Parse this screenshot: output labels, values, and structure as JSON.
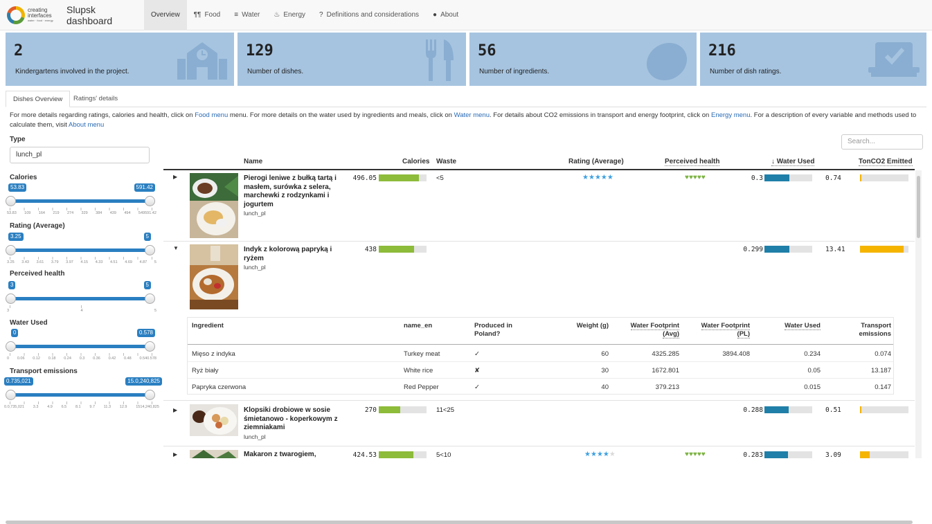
{
  "app": {
    "title": "Slupsk dashboard",
    "logo_line1": "creating",
    "logo_line2": "interfaces",
    "logo_line3": "water · food · energy"
  },
  "nav": [
    {
      "label": "Overview",
      "icon": "none",
      "active": true
    },
    {
      "label": "Food",
      "icon": "utensils-icon"
    },
    {
      "label": "Water",
      "icon": "bars-icon"
    },
    {
      "label": "Energy",
      "icon": "flame-icon"
    },
    {
      "label": "Definitions and considerations",
      "icon": "question-icon"
    },
    {
      "label": "About",
      "icon": "info-icon"
    }
  ],
  "value_boxes": [
    {
      "value": "2",
      "label": "Kindergartens involved in the project.",
      "icon": "school-icon"
    },
    {
      "value": "129",
      "label": "Number of dishes.",
      "icon": "utensils-icon"
    },
    {
      "value": "56",
      "label": "Number of ingredients.",
      "icon": "lemon-icon"
    },
    {
      "value": "216",
      "label": "Number of dish ratings.",
      "icon": "check-box-icon"
    }
  ],
  "value_box_color": "#a6c4e0",
  "tabs": [
    "Dishes Overview",
    "Ratings' details"
  ],
  "info": {
    "p1": "For more details regarding ratings, calories and health, click on ",
    "l1": "Food menu",
    "p2": " menu. For more details on the water used by ingredients and meals, click on ",
    "l2": "Water menu",
    "p3": ". For details about CO2 emissions in transport and energy footprint, click on ",
    "l3": "Energy menu",
    "p4": ". For a description of every variable and methods used to calculate them, visit ",
    "l4": "About menu"
  },
  "filters": {
    "type_label": "Type",
    "type_value": "lunch_pl",
    "calories": {
      "label": "Calories",
      "min": "53.83",
      "max": "591.42",
      "grid": [
        "53.83",
        "109",
        "164",
        "219",
        "274",
        "329",
        "384",
        "439",
        "494",
        "549591.42"
      ]
    },
    "rating": {
      "label": "Rating (Average)",
      "min": "3.25",
      "max": "5",
      "grid": [
        "3.25",
        "3.43",
        "3.61",
        "3.79",
        "3.97",
        "4.15",
        "4.33",
        "4.51",
        "4.69",
        "4.87",
        "5"
      ]
    },
    "health": {
      "label": "Perceived health",
      "min": "3",
      "max": "5",
      "grid": [
        "3",
        "4",
        "5"
      ]
    },
    "water": {
      "label": "Water Used",
      "min": "0",
      "max": "0.578",
      "grid": [
        "0",
        "0.06",
        "0.12",
        "0.18",
        "0.24",
        "0.3",
        "0.36",
        "0.42",
        "0.48",
        "0.540.578"
      ]
    },
    "transport": {
      "label": "Transport emissions",
      "min": "0.735,021",
      "max": "15.0,240,825",
      "grid": [
        "0.0,735,021",
        "3.3",
        "4.9",
        "6.5",
        "8.1",
        "9.7",
        "11.3",
        "12.9",
        "1514,240,825"
      ]
    }
  },
  "search_placeholder": "Search...",
  "table": {
    "headers": {
      "name": "Name",
      "calories": "Calories",
      "waste": "Waste",
      "rating": "Rating (Average)",
      "health": "Perceived health",
      "water": "↓ Water Used",
      "co2": "TonCO2 Emitted"
    },
    "rows": [
      {
        "expanded": false,
        "name": "Pierogi leniwe z bułką tartą i masłem, surówka z selera, marchewki z rodzynkami i jogurtem",
        "type": "lunch_pl",
        "calories": "496.05",
        "calories_frac": 0.84,
        "waste": "<5",
        "rating_stars": 5,
        "health_hearts": 5,
        "water": "0.3",
        "water_frac": 0.52,
        "co2": "0.74",
        "co2_frac": 0.03
      },
      {
        "expanded": true,
        "name": "Indyk z kolorową papryką i ryżem",
        "type": "lunch_pl",
        "calories": "438",
        "calories_frac": 0.74,
        "waste": "",
        "rating_stars": 0,
        "health_hearts": 0,
        "water": "0.299",
        "water_frac": 0.52,
        "co2": "13.41",
        "co2_frac": 0.9
      },
      {
        "expanded": false,
        "name": "Klopsiki drobiowe w sosie śmietanowo - koperkowym z ziemniakami",
        "type": "lunch_pl",
        "calories": "270",
        "calories_frac": 0.45,
        "waste": "11<25",
        "rating_stars": 0,
        "health_hearts": 0,
        "water": "0.288",
        "water_frac": 0.5,
        "co2": "0.51",
        "co2_frac": 0.03
      },
      {
        "expanded": false,
        "name": "Makaron z twarogiem,",
        "type": "",
        "calories": "424.53",
        "calories_frac": 0.72,
        "waste": "5<10",
        "rating_stars": 4,
        "health_hearts": 5,
        "water": "0.283",
        "water_frac": 0.49,
        "co2": "3.09",
        "co2_frac": 0.2
      }
    ]
  },
  "ingredients": {
    "headers": {
      "ingredient": "Ingredient",
      "name_en": "name_en",
      "produced": "Produced in Poland?",
      "weight": "Weight (g)",
      "wf_avg": "Water Footprint (Avg)",
      "wf_pl": "Water Footprint (PL)",
      "water_used": "Water Used",
      "transport": "Transport emissions"
    },
    "rows": [
      {
        "ingredient": "Mięso z indyka",
        "name_en": "Turkey meat",
        "produced": "✓",
        "weight": "60",
        "wf_avg": "4325.285",
        "wf_pl": "3894.408",
        "water_used": "0.234",
        "transport": "0.074"
      },
      {
        "ingredient": "Ryż biały",
        "name_en": "White rice",
        "produced": "✘",
        "weight": "30",
        "wf_avg": "1672.801",
        "wf_pl": "",
        "water_used": "0.05",
        "transport": "13.187"
      },
      {
        "ingredient": "Papryka czerwona",
        "name_en": "Red Pepper",
        "produced": "✓",
        "weight": "40",
        "wf_avg": "379.213",
        "wf_pl": "",
        "water_used": "0.015",
        "transport": "0.147"
      }
    ]
  },
  "colors": {
    "calories": "#8dbb3a",
    "water": "#1f7fa8",
    "co2": "#f5b400",
    "stars": "#3ea0e0",
    "hearts": "#7cb342",
    "slider": "#2a7fc1"
  }
}
